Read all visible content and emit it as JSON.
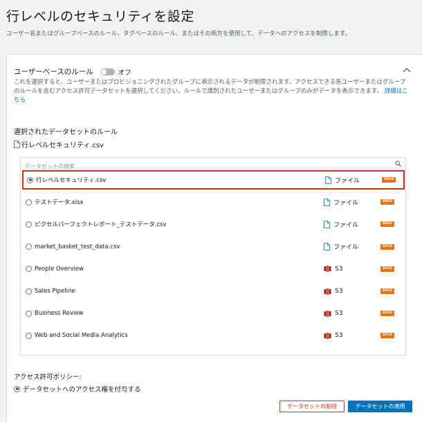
{
  "page": {
    "title": "行レベルのセキュリティを設定",
    "subtitle": "ユーザー名またはグループベースのルール、タグベースのルール、またはその両方を使用して、データへのアクセスを制限します。"
  },
  "user_rules": {
    "title": "ユーザーベースのルール",
    "toggle_state": "オフ",
    "description": "これを選択すると、ユーザーまたはプロビジョニングされたグループに表示されるデータが制限されます。アクセスできる各ユーザーまたはグループのルールを含むアクセス許可データセットを選択してください。ルールで識別されたユーザーまたはグループのみがデータを表示できます。",
    "learn_more": "詳細はこちら"
  },
  "selected_rules": {
    "label": "選択されたデータセットのルール",
    "file": "行レベルセキュリティ.csv"
  },
  "search": {
    "placeholder": "データセットの検索"
  },
  "datasets": [
    {
      "name": "行レベルセキュリティ.csv",
      "type": "ファイル",
      "icon": "file-icon",
      "badge": "SPICE",
      "selected": true
    },
    {
      "name": "テストデータ.xlsx",
      "type": "ファイル",
      "icon": "file-icon",
      "badge": "SPICE",
      "selected": false
    },
    {
      "name": "ピクセルパーフェクトレポート_テストデータ.csv",
      "type": "ファイル",
      "icon": "file-icon",
      "badge": "SPICE",
      "selected": false
    },
    {
      "name": "market_basket_test_data.csv",
      "type": "ファイル",
      "icon": "file-icon",
      "badge": "SPICE",
      "selected": false
    },
    {
      "name": "People Overview",
      "type": "S3",
      "icon": "s3-bucket-icon",
      "badge": "SPICE",
      "selected": false
    },
    {
      "name": "Sales Pipeline",
      "type": "S3",
      "icon": "s3-bucket-icon",
      "badge": "SPICE",
      "selected": false
    },
    {
      "name": "Business Review",
      "type": "S3",
      "icon": "s3-bucket-icon",
      "badge": "SPICE",
      "selected": false
    },
    {
      "name": "Web and Social Media Analytics",
      "type": "S3",
      "icon": "s3-bucket-icon",
      "badge": "SPICE",
      "selected": false
    }
  ],
  "policy": {
    "label": "アクセス許可ポリシー:",
    "option": "データセットへのアクセス権を付与する"
  },
  "buttons": {
    "delete": "データセットの削除",
    "apply": "データセットの適用"
  },
  "colors": {
    "accent": "#0073bb",
    "danger": "#d13212",
    "spice": "#ec7211"
  }
}
